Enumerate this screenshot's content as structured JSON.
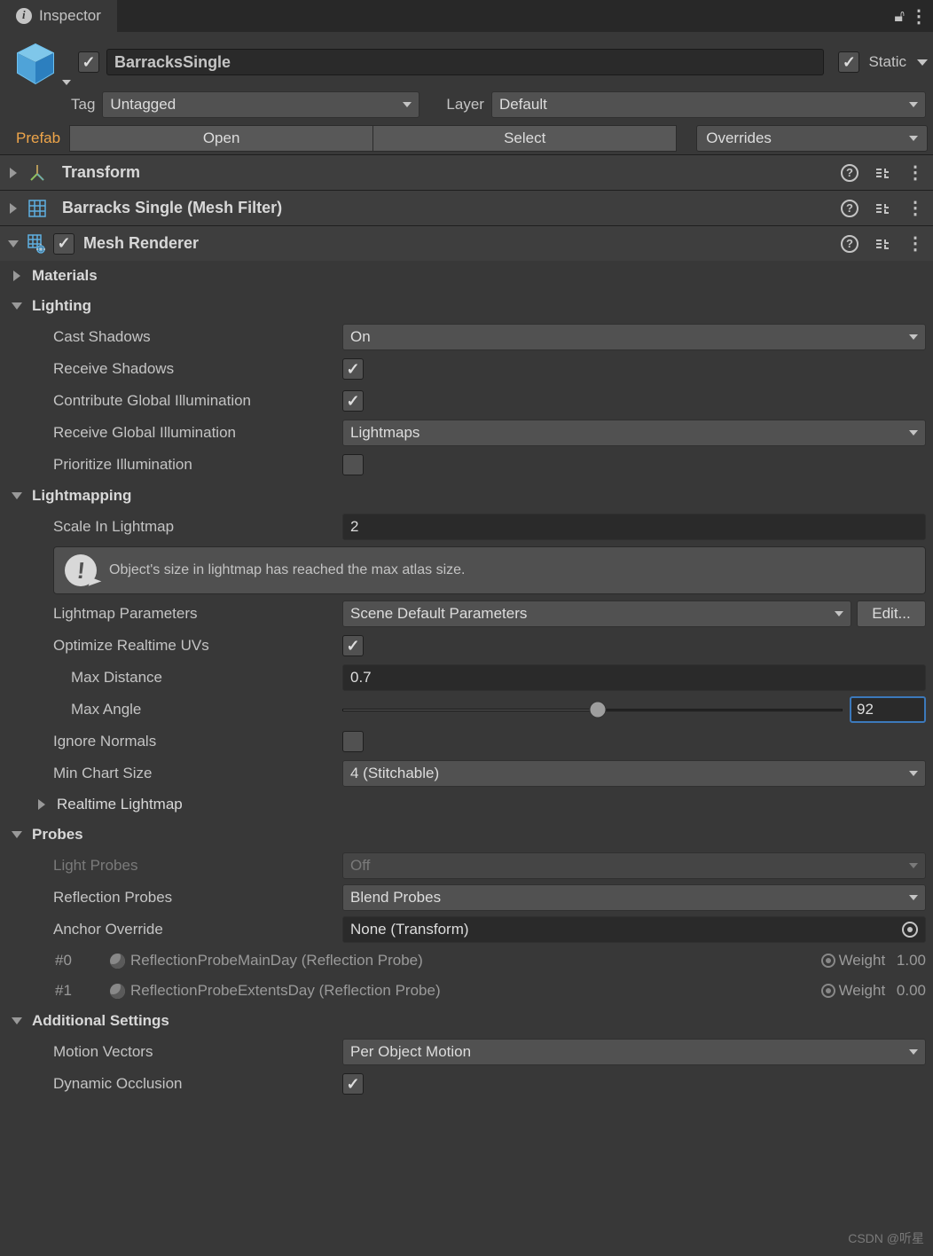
{
  "tab": {
    "title": "Inspector"
  },
  "topRight": {
    "lockState": "unlocked"
  },
  "object": {
    "enabled": true,
    "name": "BarracksSingle",
    "static": {
      "label": "Static",
      "checked": true
    }
  },
  "meta": {
    "tagLabel": "Tag",
    "tag": "Untagged",
    "layerLabel": "Layer",
    "layer": "Default"
  },
  "prefab": {
    "label": "Prefab",
    "open": "Open",
    "select": "Select",
    "overrides": "Overrides"
  },
  "components": {
    "transform": {
      "title": "Transform"
    },
    "meshFilter": {
      "title": "Barracks Single (Mesh Filter)"
    },
    "meshRenderer": {
      "title": "Mesh Renderer",
      "enabled": true
    }
  },
  "mr": {
    "sections": {
      "materials": "Materials",
      "lighting": "Lighting",
      "lightmapping": "Lightmapping",
      "probes": "Probes",
      "additional": "Additional Settings",
      "realtimeLightmap": "Realtime Lightmap"
    },
    "lighting": {
      "castShadowsLabel": "Cast Shadows",
      "castShadows": "On",
      "receiveShadowsLabel": "Receive Shadows",
      "receiveShadows": true,
      "contributeGILabel": "Contribute Global Illumination",
      "contributeGI": true,
      "receiveGILabel": "Receive Global Illumination",
      "receiveGI": "Lightmaps",
      "prioritizeLabel": "Prioritize Illumination",
      "prioritize": false
    },
    "lightmapping": {
      "scaleLabel": "Scale In Lightmap",
      "scale": "2",
      "infoMsg": "Object's size in lightmap has reached the max atlas size.",
      "paramsLabel": "Lightmap Parameters",
      "params": "Scene Default Parameters",
      "editBtn": "Edit...",
      "optimizeLabel": "Optimize Realtime UVs",
      "optimize": true,
      "maxDistanceLabel": "Max Distance",
      "maxDistance": "0.7",
      "maxAngleLabel": "Max Angle",
      "maxAngle": "92",
      "maxAnglePercent": 51,
      "ignoreNormalsLabel": "Ignore Normals",
      "ignoreNormals": false,
      "minChartLabel": "Min Chart Size",
      "minChart": "4 (Stitchable)"
    },
    "probes": {
      "lightProbesLabel": "Light Probes",
      "lightProbes": "Off",
      "reflectionProbesLabel": "Reflection Probes",
      "reflectionProbes": "Blend Probes",
      "anchorLabel": "Anchor Override",
      "anchor": "None (Transform)",
      "list": [
        {
          "idx": "#0",
          "name": "ReflectionProbeMainDay (Reflection Probe)",
          "weightLabel": "Weight",
          "weight": "1.00"
        },
        {
          "idx": "#1",
          "name": "ReflectionProbeExtentsDay (Reflection Probe)",
          "weightLabel": "Weight",
          "weight": "0.00"
        }
      ]
    },
    "additional": {
      "motionLabel": "Motion Vectors",
      "motion": "Per Object Motion",
      "dynamicOccLabel": "Dynamic Occlusion",
      "dynamicOcc": true
    }
  },
  "watermark": "CSDN @听星"
}
